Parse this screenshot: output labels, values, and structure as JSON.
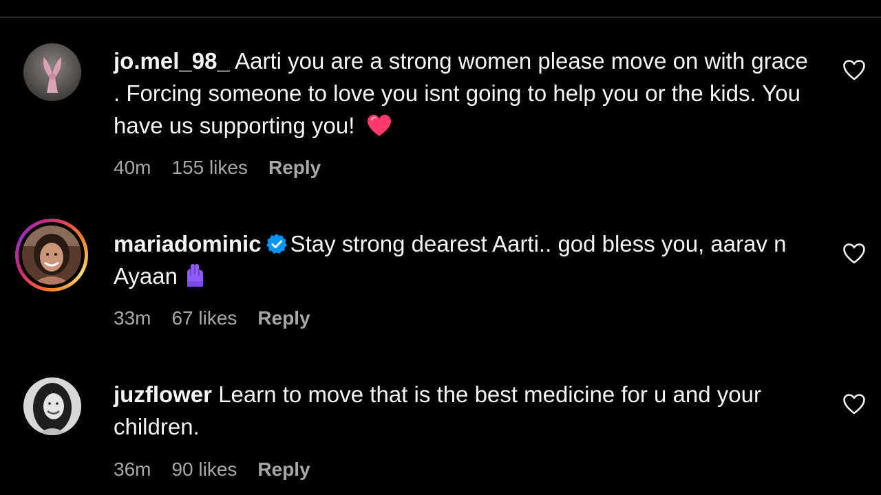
{
  "comments": [
    {
      "username": "jo.mel_98_",
      "verified": false,
      "text": "Aarti you are a strong women please move on with grace . Forcing someone to love you isnt going to help you or the kids. You have us supporting you!",
      "emoji": "heart-emoji",
      "time": "40m",
      "likes": "155 likes",
      "reply_label": "Reply"
    },
    {
      "username": "mariadominic",
      "verified": true,
      "text": "Stay strong dearest Aarti.. god bless you, aarav n Ayaan",
      "emoji": "hands-emoji",
      "time": "33m",
      "likes": "67 likes",
      "reply_label": "Reply"
    },
    {
      "username": "juzflower",
      "verified": false,
      "text": "Learn to move that is the best medicine for u and your children.",
      "time": "36m",
      "likes": "90 likes",
      "reply_label": "Reply"
    }
  ],
  "colors": {
    "background": "#000000",
    "text": "#f5f5f5",
    "meta": "#a8a8a8",
    "verified": "#0095f6",
    "heart_emoji": "#ff3b6b",
    "story_ring": "#d62976"
  },
  "icons": {
    "like": "heart-outline-icon",
    "verified": "verified-badge-icon"
  }
}
